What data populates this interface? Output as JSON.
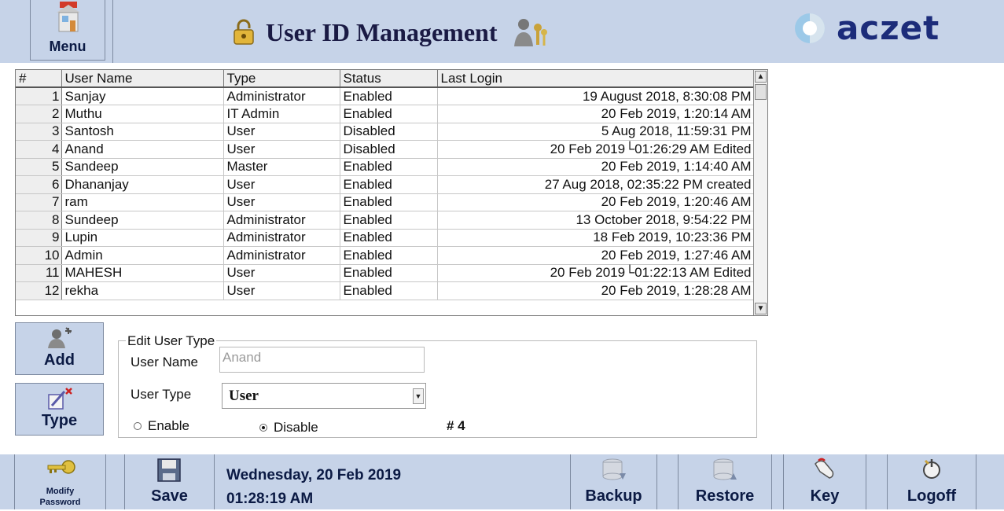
{
  "header": {
    "menu_label": "Menu",
    "title": "User ID Management",
    "brand": "aczet"
  },
  "grid": {
    "columns": [
      "#",
      "User Name",
      "Type",
      "Status",
      "Last Login"
    ],
    "rows": [
      {
        "num": "1",
        "name": "Sanjay",
        "type": "Administrator",
        "status": "Enabled",
        "last": "19  August  2018,  8:30:08  PM"
      },
      {
        "num": "2",
        "name": "Muthu",
        "type": "IT Admin",
        "status": "Enabled",
        "last": "20  Feb  2019,  1:20:14  AM"
      },
      {
        "num": "3",
        "name": "Santosh",
        "type": "User",
        "status": "Disabled",
        "last": "5  Aug  2018,  11:59:31  PM"
      },
      {
        "num": "4",
        "name": "Anand",
        "type": "User",
        "status": "Disabled",
        "last": "20 Feb 2019└01:26:29 AM Edited"
      },
      {
        "num": "5",
        "name": "Sandeep",
        "type": "Master",
        "status": "Enabled",
        "last": "20  Feb  2019,  1:14:40  AM"
      },
      {
        "num": "6",
        "name": "Dhananjay",
        "type": "User",
        "status": "Enabled",
        "last": "27 Aug 2018, 02:35:22 PM created"
      },
      {
        "num": "7",
        "name": "ram",
        "type": "User",
        "status": "Enabled",
        "last": "20  Feb  2019,  1:20:46  AM"
      },
      {
        "num": "8",
        "name": "Sundeep",
        "type": "Administrator",
        "status": "Enabled",
        "last": "13  October  2018,  9:54:22  PM"
      },
      {
        "num": "9",
        "name": "Lupin",
        "type": "Administrator",
        "status": "Enabled",
        "last": "18  Feb  2019,  10:23:36  PM"
      },
      {
        "num": "10",
        "name": "Admin",
        "type": "Administrator",
        "status": "Enabled",
        "last": "20  Feb  2019,  1:27:46  AM"
      },
      {
        "num": "11",
        "name": "MAHESH",
        "type": "User",
        "status": "Enabled",
        "last": "20 Feb 2019└01:22:13 AM Edited"
      },
      {
        "num": "12",
        "name": "rekha",
        "type": "User",
        "status": "Enabled",
        "last": "20  Feb  2019,  1:28:28  AM"
      }
    ]
  },
  "side": {
    "add_label": "Add",
    "type_label": "Type"
  },
  "edit": {
    "legend": "Edit User Type",
    "user_name_label": "User Name",
    "user_name_value": "Anand",
    "user_type_label": "User Type",
    "user_type_value": "User",
    "enable_label": "Enable",
    "disable_label": "Disable",
    "selected_status": "Disable",
    "index": "#  4"
  },
  "footer": {
    "modify_password_line1": "Modify",
    "modify_password_line2": "Password",
    "save_label": "Save",
    "date": "Wednesday, 20 Feb 2019",
    "time": "01:28:19 AM",
    "backup_label": "Backup",
    "restore_label": "Restore",
    "key_label": "Key",
    "logoff_label": "Logoff"
  },
  "colors": {
    "panel": "#c6d3e8",
    "brand_blue": "#1c2c7a",
    "grid_header": "#eeeeee"
  }
}
